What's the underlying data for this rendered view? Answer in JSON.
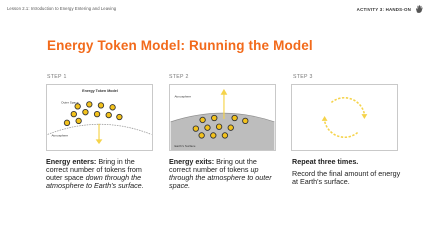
{
  "header": {
    "lesson": "Lesson 2.1: Introduction to Energy Entering and Leaving",
    "activity": "ACTIVITY 3: HANDS-ON"
  },
  "title": "Energy Token Model: Running the Model",
  "colors": {
    "accent": "#f26a1b",
    "token": "#f3c21c",
    "arrow": "#f5d34a"
  },
  "steps": [
    {
      "label": "STEP 1",
      "diagram": {
        "title": "Energy Token Model",
        "outer_space": "Outer Space",
        "atmosphere": "Atmosphere"
      },
      "desc_bold": "Energy enters:",
      "desc_1": " Bring in the correct number of tokens from outer space ",
      "desc_italic": "down through the atmosphere to Earth's surface."
    },
    {
      "label": "STEP 2",
      "diagram": {
        "atmosphere": "Atmosphere",
        "earth_surface": "Earth's Surface"
      },
      "desc_bold": "Energy exits:",
      "desc_1": " Bring out the correct number of tokens ",
      "desc_italic": "up through the atmosphere to outer space."
    },
    {
      "label": "STEP 3",
      "desc_bold": "Repeat three times.",
      "desc_2": "Record the final amount of energy at Earth's surface."
    }
  ]
}
